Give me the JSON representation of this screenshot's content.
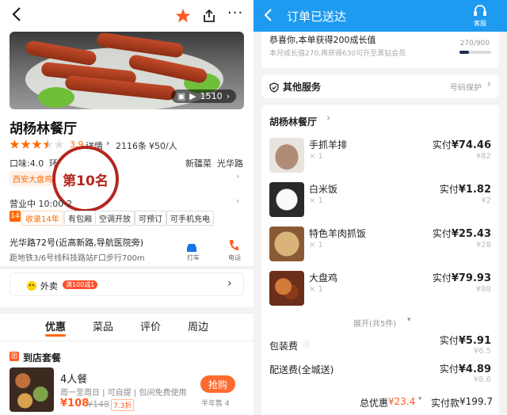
{
  "left": {
    "header": {
      "back_icon": "chevron-left-icon",
      "favorite_icon": "star-icon",
      "share_icon": "share-icon",
      "more_icon": "more-dots-icon"
    },
    "photo": {
      "video_count": "1510"
    },
    "restaurant": {
      "name": "胡杨林餐厅",
      "rating": "3.9",
      "rating_fraction": 0.78,
      "details_link": "详情",
      "review_count": "2116条",
      "price": "¥50/人",
      "taste_score": "口味:4.0",
      "env_label": "环",
      "cuisine": "新疆菜",
      "area": "光华路",
      "rank_tag": "西安大盘鸡",
      "rank_stamp": "第10名",
      "hours": "营业中 10:00-2",
      "years_badge_num": "14",
      "years_text": "收录14年",
      "features": [
        "有包厢",
        "空调开放",
        "可预订",
        "可手机充电"
      ],
      "address": "光华路72号(近高新路,导航医院旁)",
      "distance": "距地铁3/6号线科技路站F口步行700m",
      "taxi_label": "打车",
      "phone_label": "电话"
    },
    "takeout": {
      "label": "外卖",
      "badge": "满100减1"
    },
    "tabs": [
      "优惠",
      "菜品",
      "评价",
      "周边"
    ],
    "deal_section": {
      "title": "到店套餐"
    },
    "deal": {
      "name": "4人餐",
      "desc": "周一至周日 | 可自提 | 包间免费使用",
      "price": "¥108",
      "orig_price": "¥148",
      "discount": "7.3折",
      "sold": "半年售 4",
      "buy_label": "抢购"
    }
  },
  "right": {
    "header": {
      "title": "订单已送达",
      "service_label": "客服"
    },
    "growth": {
      "title": "恭喜你,本单获得200成长值",
      "subtitle": "本月成长值270,再获得630可升至黑钻会员",
      "progress_text": "270/900",
      "progress": 0.3
    },
    "services": {
      "title": "其他服务",
      "right": "号码保护"
    },
    "order": {
      "restaurant": "胡杨林餐厅",
      "items": [
        {
          "name": "手抓羊排",
          "qty": "× 1",
          "paid": "实付",
          "amount": "¥74.46",
          "orig": "¥82"
        },
        {
          "name": "白米饭",
          "qty": "× 1",
          "paid": "实付",
          "amount": "¥1.82",
          "orig": "¥2"
        },
        {
          "name": "特色羊肉抓饭",
          "qty": "× 1",
          "paid": "实付",
          "amount": "¥25.43",
          "orig": "¥28"
        },
        {
          "name": "大盘鸡",
          "qty": "× 1",
          "paid": "实付",
          "amount": "¥79.93",
          "orig": "¥88"
        }
      ],
      "expand": "展开(共5件)",
      "packing": {
        "label": "包装费",
        "paid": "实付",
        "amount": "¥5.91",
        "orig": "¥6.5"
      },
      "delivery": {
        "label": "配送费(全城送)",
        "paid": "实付",
        "amount": "¥4.89",
        "orig": "¥8.6"
      },
      "total_discount_label": "总优惠",
      "total_discount": "¥23.4",
      "total_paid_label": "实付款",
      "total_paid": "¥199.7"
    }
  }
}
